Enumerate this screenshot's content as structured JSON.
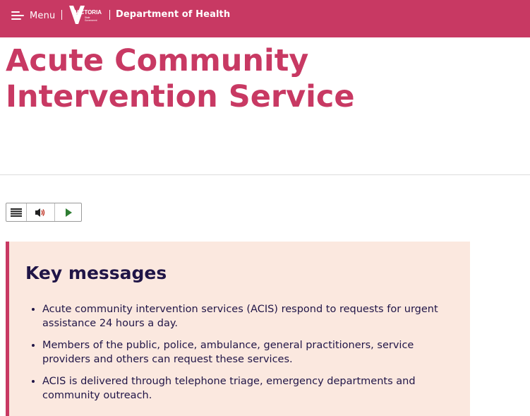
{
  "header": {
    "menu_label": "Menu",
    "logo_text": "VICTORIA",
    "logo_subtext": "State Government",
    "department": "Department of Health",
    "brand_color": "#c83963"
  },
  "page": {
    "title": "Acute Community Intervention Service"
  },
  "readspeaker": {
    "buttons": [
      "menu-icon",
      "speaker-icon",
      "play-icon"
    ]
  },
  "key_messages": {
    "heading": "Key messages",
    "items": [
      "Acute community intervention services (ACIS) respond to requests for urgent assistance 24 hours a day.",
      "Members of the public, police, ambulance, general practitioners, service providers and others can request these services.",
      "ACIS is delivered through telephone triage, emergency departments and community outreach."
    ],
    "background": "#fbe8df",
    "accent": "#c83963"
  }
}
